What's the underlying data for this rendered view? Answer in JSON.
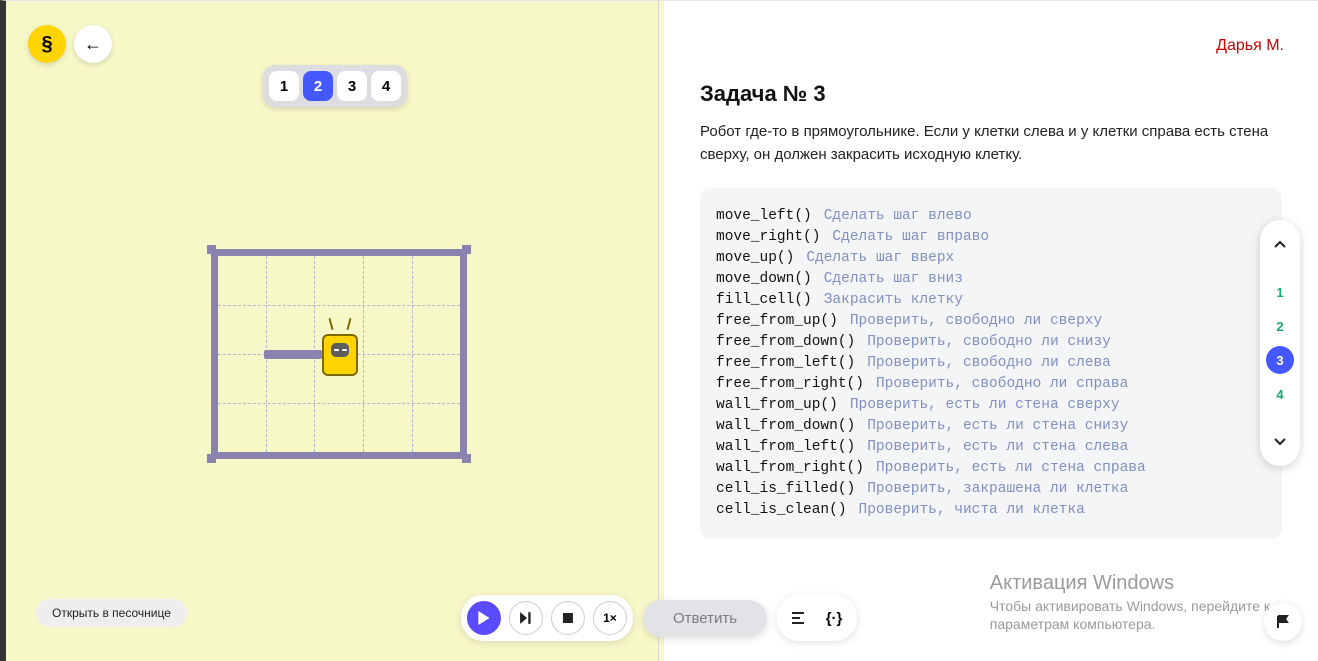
{
  "header": {
    "logo_glyph": "§",
    "user_name": "Дарья М."
  },
  "steps": {
    "items": [
      "1",
      "2",
      "3",
      "4"
    ],
    "active_index": 1
  },
  "sandbox_button": "Открыть в песочнице",
  "controls": {
    "speed_label": "1×",
    "answer_label": "Ответить"
  },
  "task": {
    "title": "Задача № 3",
    "description": "Робот где-то в прямоугольнике. Если у клетки слева и у клетки справа есть стена сверху, он должен закрасить исходную клетку."
  },
  "commands": [
    {
      "fn": "move_left()",
      "comment": "Сделать шаг влево"
    },
    {
      "fn": "move_right()",
      "comment": "Сделать шаг вправо"
    },
    {
      "fn": "move_up()",
      "comment": "Сделать шаг вверх"
    },
    {
      "fn": "move_down()",
      "comment": "Сделать шаг вниз"
    },
    {
      "fn": "fill_cell()",
      "comment": "Закрасить клетку"
    },
    {
      "fn": "free_from_up()",
      "comment": "Проверить, свободно ли сверху"
    },
    {
      "fn": "free_from_down()",
      "comment": "Проверить, свободно ли снизу"
    },
    {
      "fn": "free_from_left()",
      "comment": "Проверить, свободно ли слева"
    },
    {
      "fn": "free_from_right()",
      "comment": "Проверить, свободно ли справа"
    },
    {
      "fn": "wall_from_up()",
      "comment": "Проверить, есть ли стена сверху"
    },
    {
      "fn": "wall_from_down()",
      "comment": "Проверить, есть ли стена снизу"
    },
    {
      "fn": "wall_from_left()",
      "comment": "Проверить, есть ли стена слева"
    },
    {
      "fn": "wall_from_right()",
      "comment": "Проверить, есть ли стена справа"
    },
    {
      "fn": "cell_is_filled()",
      "comment": "Проверить, закрашена ли клетка"
    },
    {
      "fn": "cell_is_clean()",
      "comment": "Проверить, чиста ли клетка"
    }
  ],
  "mini_nav": {
    "items": [
      "1",
      "2",
      "3",
      "4"
    ],
    "active_index": 2
  },
  "watermark": {
    "title": "Активация Windows",
    "line1": "Чтобы активировать Windows, перейдите к",
    "line2": "параметрам компьютера."
  }
}
